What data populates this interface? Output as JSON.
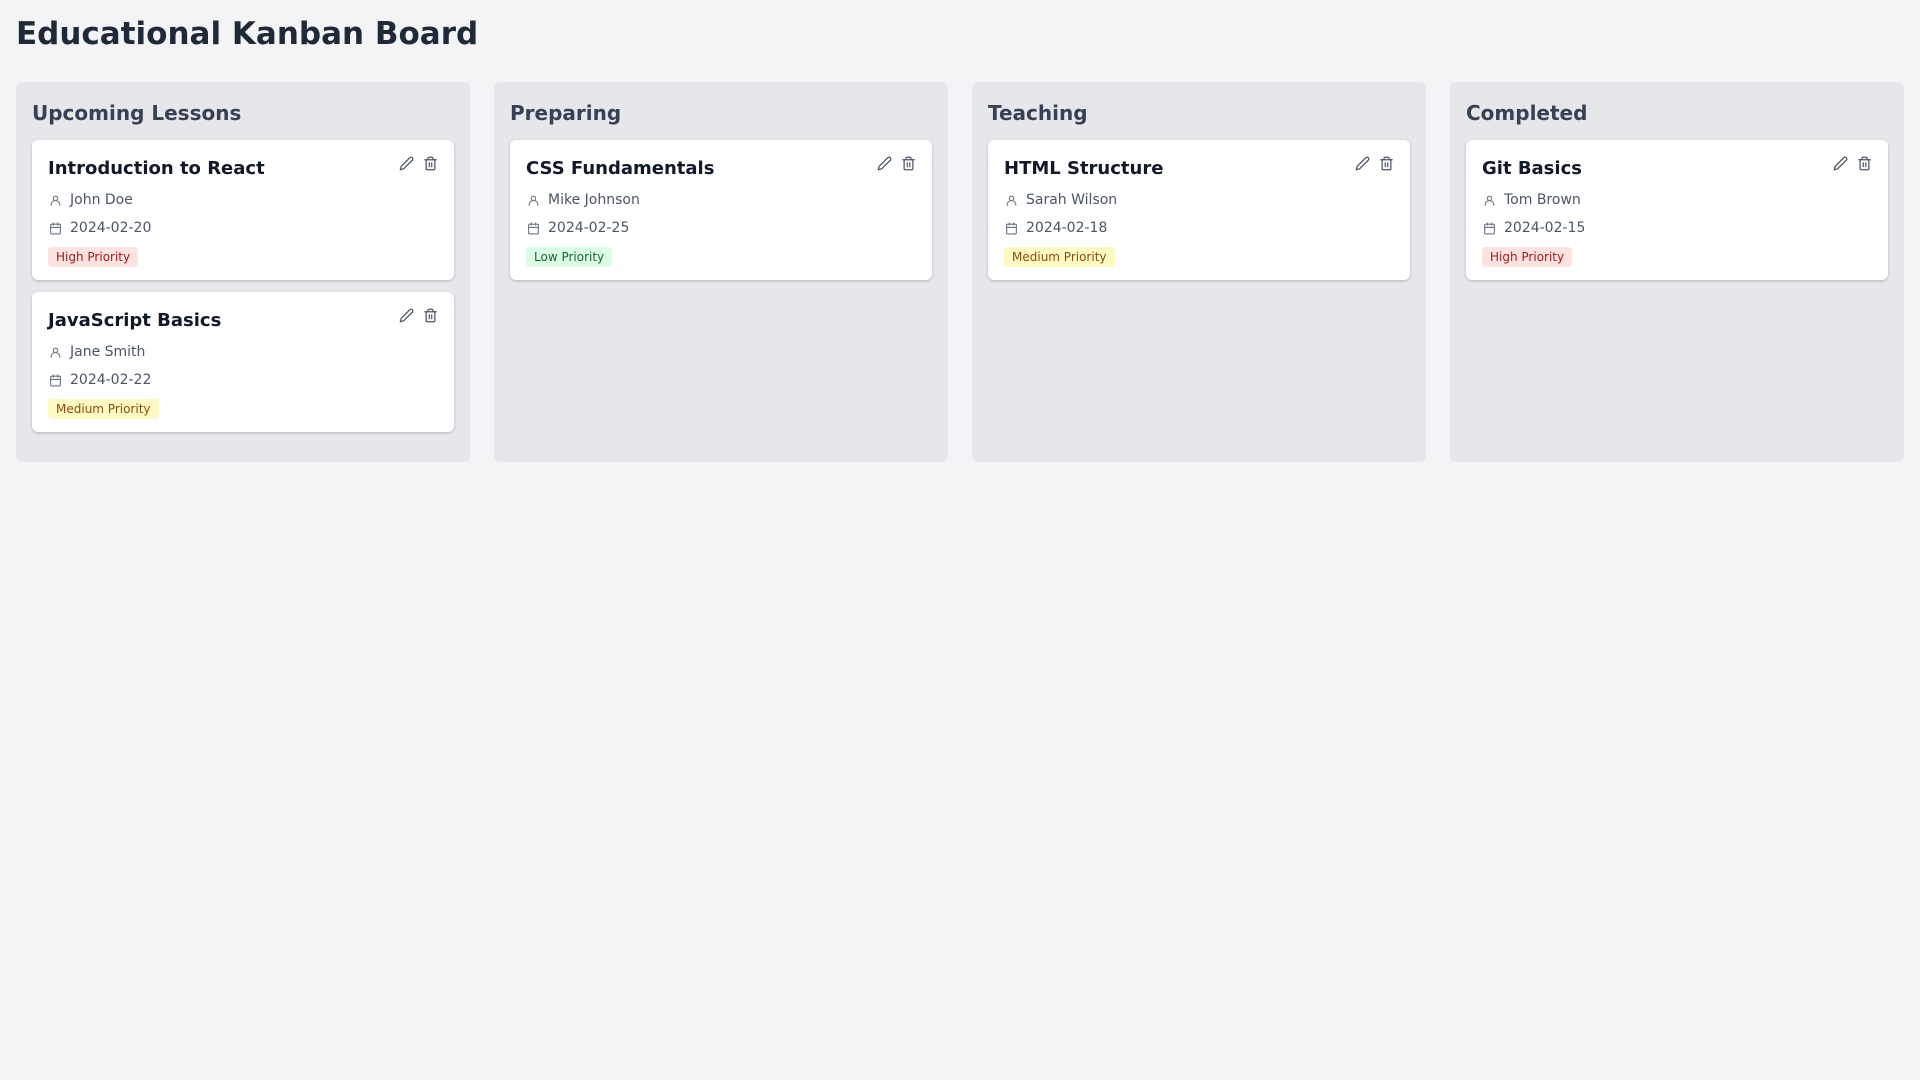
{
  "page": {
    "title": "Educational Kanban Board"
  },
  "columns": [
    {
      "title": "Upcoming Lessons",
      "cards": [
        {
          "title": "Introduction to React",
          "teacher": "John Doe",
          "date": "2024-02-20",
          "priority": "High Priority",
          "priority_level": "high"
        },
        {
          "title": "JavaScript Basics",
          "teacher": "Jane Smith",
          "date": "2024-02-22",
          "priority": "Medium Priority",
          "priority_level": "medium"
        }
      ]
    },
    {
      "title": "Preparing",
      "cards": [
        {
          "title": "CSS Fundamentals",
          "teacher": "Mike Johnson",
          "date": "2024-02-25",
          "priority": "Low Priority",
          "priority_level": "low"
        }
      ]
    },
    {
      "title": "Teaching",
      "cards": [
        {
          "title": "HTML Structure",
          "teacher": "Sarah Wilson",
          "date": "2024-02-18",
          "priority": "Medium Priority",
          "priority_level": "medium"
        }
      ]
    },
    {
      "title": "Completed",
      "cards": [
        {
          "title": "Git Basics",
          "teacher": "Tom Brown",
          "date": "2024-02-15",
          "priority": "High Priority",
          "priority_level": "high"
        }
      ]
    }
  ],
  "icons": {
    "edit": "pencil-icon",
    "delete": "trash-icon",
    "teacher": "user-icon",
    "date": "calendar-icon"
  },
  "colors": {
    "high_bg": "#fee2e2",
    "high_text": "#991b1b",
    "medium_bg": "#fef9c3",
    "medium_text": "#854d0e",
    "low_bg": "#dcfce7",
    "low_text": "#166534"
  }
}
